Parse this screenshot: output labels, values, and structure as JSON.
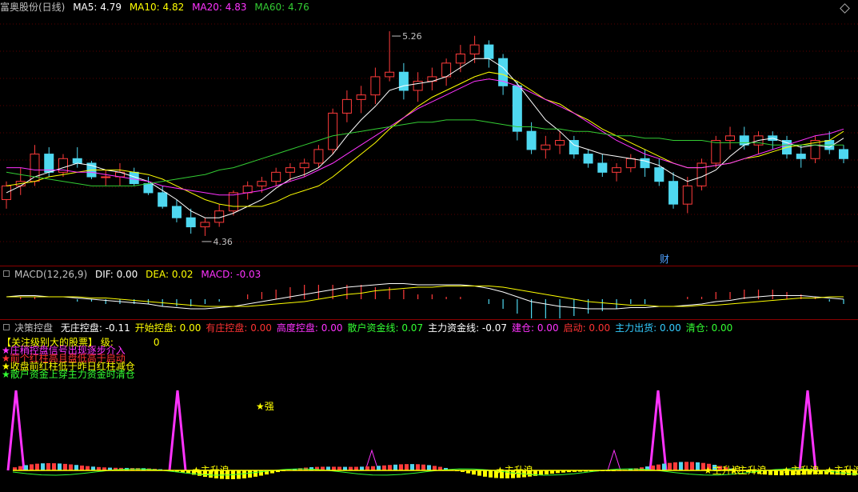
{
  "main_header": {
    "title": "富奥股份(日线)",
    "ma": [
      {
        "label": "MA5:",
        "value": "4.79",
        "color": "#ffffff"
      },
      {
        "label": "MA10:",
        "value": "4.82",
        "color": "#ffff00"
      },
      {
        "label": "MA20:",
        "value": "4.83",
        "color": "#ff33ff"
      },
      {
        "label": "MA60:",
        "value": "4.76",
        "color": "#33cc33"
      }
    ],
    "corner_icon": "diamond-icon"
  },
  "price_annotations": {
    "high": "5.26",
    "low": "4.36",
    "cai": "财"
  },
  "macd_header": {
    "title": "MACD(12,26,9)",
    "dif_label": "DIF:",
    "dif": "0.00",
    "dea_label": "DEA:",
    "dea": "0.02",
    "macd_label": "MACD:",
    "macd": "-0.03"
  },
  "indicator_header": {
    "title": "决策控盘",
    "items": [
      {
        "label": "无庄控盘:",
        "value": "-0.11",
        "color": "#ffffff"
      },
      {
        "label": "开始控盘:",
        "value": "0.00",
        "color": "#ffff00"
      },
      {
        "label": "有庄控盘:",
        "value": "0.00",
        "color": "#ff3333"
      },
      {
        "label": "高度控盘:",
        "value": "0.00",
        "color": "#ff33ff"
      },
      {
        "label": "散户资金线:",
        "value": "0.07",
        "color": "#33ff33"
      },
      {
        "label": "主力资金线:",
        "value": "-0.07",
        "color": "#ffffff"
      },
      {
        "label": "建仓:",
        "value": "0.00",
        "color": "#ff33ff"
      },
      {
        "label": "启动:",
        "value": "0.00",
        "color": "#ff3333"
      },
      {
        "label": "主力出货:",
        "value": "0.00",
        "color": "#33ccff"
      },
      {
        "label": "清仓:",
        "value": "0.00",
        "color": "#33ff33"
      }
    ]
  },
  "indicator_legend": [
    {
      "text": "【关注级别大的股票】  级:",
      "value": "0",
      "color": "#ffff00"
    },
    {
      "text": "★庄稍控盘信号出现逐步介入",
      "color": "#ff33ff"
    },
    {
      "text": "★前个红柱高且盘低高于启动",
      "color": "#ff3333"
    },
    {
      "text": "★收盘前红柱低于昨日红柱减仓",
      "color": "#ffff00"
    },
    {
      "text": "★散户资金上穿主力资金时清仓",
      "color": "#33ff33"
    }
  ],
  "indicator_marks": {
    "strong": "★强",
    "wave": "★主升浪"
  },
  "chart_data": {
    "type": "candlestick",
    "title": "富奥股份(日线)",
    "ylim": [
      4.3,
      5.32
    ],
    "annotated_high": 5.26,
    "annotated_low": 4.36,
    "ohlc": [
      [
        4.52,
        4.6,
        4.48,
        4.58
      ],
      [
        4.58,
        4.66,
        4.54,
        4.6
      ],
      [
        4.6,
        4.76,
        4.58,
        4.72
      ],
      [
        4.72,
        4.75,
        4.62,
        4.64
      ],
      [
        4.64,
        4.72,
        4.62,
        4.7
      ],
      [
        4.7,
        4.75,
        4.66,
        4.68
      ],
      [
        4.68,
        4.69,
        4.61,
        4.62
      ],
      [
        4.62,
        4.65,
        4.58,
        4.62
      ],
      [
        4.62,
        4.68,
        4.58,
        4.64
      ],
      [
        4.64,
        4.66,
        4.58,
        4.59
      ],
      [
        4.59,
        4.62,
        4.54,
        4.55
      ],
      [
        4.55,
        4.58,
        4.48,
        4.49
      ],
      [
        4.49,
        4.52,
        4.42,
        4.44
      ],
      [
        4.44,
        4.48,
        4.37,
        4.4
      ],
      [
        4.4,
        4.44,
        4.36,
        4.42
      ],
      [
        4.42,
        4.5,
        4.4,
        4.47
      ],
      [
        4.47,
        4.56,
        4.45,
        4.55
      ],
      [
        4.55,
        4.6,
        4.52,
        4.58
      ],
      [
        4.58,
        4.62,
        4.55,
        4.6
      ],
      [
        4.6,
        4.66,
        4.58,
        4.64
      ],
      [
        4.64,
        4.68,
        4.6,
        4.66
      ],
      [
        4.66,
        4.7,
        4.62,
        4.68
      ],
      [
        4.68,
        4.76,
        4.66,
        4.74
      ],
      [
        4.74,
        4.92,
        4.72,
        4.9
      ],
      [
        4.9,
        5.0,
        4.86,
        4.96
      ],
      [
        4.96,
        5.02,
        4.9,
        4.98
      ],
      [
        4.98,
        5.1,
        4.94,
        5.06
      ],
      [
        5.06,
        5.26,
        5.04,
        5.08
      ],
      [
        5.08,
        5.12,
        4.96,
        5.0
      ],
      [
        5.0,
        5.08,
        4.95,
        5.04
      ],
      [
        5.04,
        5.1,
        5.0,
        5.06
      ],
      [
        5.06,
        5.14,
        5.02,
        5.12
      ],
      [
        5.12,
        5.2,
        5.08,
        5.16
      ],
      [
        5.16,
        5.24,
        5.12,
        5.2
      ],
      [
        5.2,
        5.22,
        5.1,
        5.14
      ],
      [
        5.14,
        5.16,
        4.98,
        5.02
      ],
      [
        5.02,
        5.04,
        4.78,
        4.82
      ],
      [
        4.82,
        4.86,
        4.72,
        4.74
      ],
      [
        4.74,
        4.8,
        4.7,
        4.76
      ],
      [
        4.76,
        4.82,
        4.72,
        4.78
      ],
      [
        4.78,
        4.8,
        4.7,
        4.72
      ],
      [
        4.72,
        4.74,
        4.66,
        4.68
      ],
      [
        4.68,
        4.72,
        4.62,
        4.64
      ],
      [
        4.64,
        4.68,
        4.6,
        4.66
      ],
      [
        4.66,
        4.72,
        4.64,
        4.7
      ],
      [
        4.7,
        4.74,
        4.62,
        4.66
      ],
      [
        4.66,
        4.7,
        4.58,
        4.6
      ],
      [
        4.6,
        4.64,
        4.48,
        4.5
      ],
      [
        4.5,
        4.62,
        4.46,
        4.58
      ],
      [
        4.58,
        4.7,
        4.56,
        4.68
      ],
      [
        4.68,
        4.8,
        4.66,
        4.78
      ],
      [
        4.78,
        4.84,
        4.74,
        4.8
      ],
      [
        4.8,
        4.84,
        4.74,
        4.76
      ],
      [
        4.76,
        4.82,
        4.72,
        4.8
      ],
      [
        4.8,
        4.82,
        4.74,
        4.78
      ],
      [
        4.78,
        4.8,
        4.7,
        4.72
      ],
      [
        4.72,
        4.76,
        4.66,
        4.7
      ],
      [
        4.7,
        4.8,
        4.68,
        4.78
      ],
      [
        4.78,
        4.82,
        4.72,
        4.74
      ],
      [
        4.74,
        4.76,
        4.68,
        4.7
      ]
    ],
    "series": [
      {
        "name": "MA5",
        "color": "#ffffff",
        "values": [
          4.55,
          4.58,
          4.62,
          4.64,
          4.66,
          4.68,
          4.67,
          4.65,
          4.64,
          4.62,
          4.6,
          4.56,
          4.52,
          4.47,
          4.44,
          4.44,
          4.46,
          4.49,
          4.52,
          4.57,
          4.61,
          4.63,
          4.66,
          4.72,
          4.8,
          4.87,
          4.93,
          5.0,
          5.02,
          5.03,
          5.04,
          5.06,
          5.1,
          5.14,
          5.14,
          5.1,
          5.03,
          4.95,
          4.87,
          4.82,
          4.76,
          4.74,
          4.72,
          4.71,
          4.7,
          4.69,
          4.67,
          4.63,
          4.6,
          4.62,
          4.65,
          4.71,
          4.76,
          4.78,
          4.79,
          4.77,
          4.75,
          4.76,
          4.75,
          4.79
        ]
      },
      {
        "name": "MA10",
        "color": "#ffff00",
        "values": [
          4.58,
          4.59,
          4.6,
          4.62,
          4.63,
          4.64,
          4.65,
          4.65,
          4.65,
          4.64,
          4.63,
          4.61,
          4.58,
          4.55,
          4.52,
          4.5,
          4.49,
          4.49,
          4.49,
          4.51,
          4.54,
          4.56,
          4.58,
          4.62,
          4.67,
          4.72,
          4.77,
          4.83,
          4.88,
          4.93,
          4.97,
          5.0,
          5.03,
          5.06,
          5.08,
          5.07,
          5.04,
          5.0,
          4.96,
          4.94,
          4.9,
          4.87,
          4.83,
          4.8,
          4.77,
          4.74,
          4.71,
          4.68,
          4.66,
          4.66,
          4.67,
          4.68,
          4.7,
          4.71,
          4.73,
          4.75,
          4.76,
          4.77,
          4.78,
          4.82
        ]
      },
      {
        "name": "MA20",
        "color": "#ff33ff",
        "values": [
          4.66,
          4.66,
          4.65,
          4.65,
          4.65,
          4.64,
          4.64,
          4.63,
          4.62,
          4.61,
          4.6,
          4.58,
          4.57,
          4.56,
          4.55,
          4.54,
          4.54,
          4.55,
          4.56,
          4.58,
          4.6,
          4.62,
          4.65,
          4.68,
          4.72,
          4.76,
          4.8,
          4.84,
          4.88,
          4.92,
          4.95,
          4.98,
          5.01,
          5.04,
          5.05,
          5.04,
          5.02,
          4.99,
          4.96,
          4.93,
          4.9,
          4.86,
          4.82,
          4.78,
          4.75,
          4.72,
          4.7,
          4.68,
          4.66,
          4.66,
          4.67,
          4.68,
          4.7,
          4.72,
          4.74,
          4.76,
          4.78,
          4.8,
          4.81,
          4.83
        ]
      },
      {
        "name": "MA60",
        "color": "#33cc33",
        "values": [
          4.64,
          4.63,
          4.62,
          4.61,
          4.6,
          4.59,
          4.58,
          4.58,
          4.58,
          4.58,
          4.59,
          4.6,
          4.61,
          4.62,
          4.63,
          4.65,
          4.66,
          4.68,
          4.7,
          4.72,
          4.74,
          4.76,
          4.78,
          4.8,
          4.81,
          4.82,
          4.83,
          4.84,
          4.85,
          4.86,
          4.86,
          4.87,
          4.87,
          4.87,
          4.86,
          4.85,
          4.84,
          4.84,
          4.83,
          4.83,
          4.82,
          4.82,
          4.81,
          4.8,
          4.8,
          4.79,
          4.79,
          4.78,
          4.78,
          4.78,
          4.77,
          4.77,
          4.77,
          4.77,
          4.76,
          4.76,
          4.76,
          4.76,
          4.76,
          4.76
        ]
      }
    ],
    "macd": {
      "dif": [
        0.02,
        0.03,
        0.03,
        0.02,
        0.02,
        0.01,
        0.0,
        -0.01,
        -0.02,
        -0.03,
        -0.04,
        -0.06,
        -0.07,
        -0.08,
        -0.08,
        -0.07,
        -0.06,
        -0.04,
        -0.02,
        0.0,
        0.02,
        0.04,
        0.06,
        0.08,
        0.1,
        0.11,
        0.12,
        0.13,
        0.13,
        0.12,
        0.12,
        0.12,
        0.12,
        0.11,
        0.09,
        0.06,
        0.02,
        -0.02,
        -0.04,
        -0.06,
        -0.07,
        -0.08,
        -0.08,
        -0.08,
        -0.07,
        -0.07,
        -0.06,
        -0.06,
        -0.05,
        -0.04,
        -0.02,
        -0.01,
        0.01,
        0.02,
        0.03,
        0.03,
        0.03,
        0.02,
        0.01,
        0.0
      ],
      "dea": [
        0.02,
        0.02,
        0.02,
        0.02,
        0.02,
        0.02,
        0.01,
        0.01,
        0.0,
        -0.01,
        -0.02,
        -0.03,
        -0.04,
        -0.05,
        -0.06,
        -0.06,
        -0.06,
        -0.06,
        -0.05,
        -0.04,
        -0.03,
        -0.02,
        0.0,
        0.02,
        0.04,
        0.05,
        0.07,
        0.08,
        0.09,
        0.1,
        0.1,
        0.11,
        0.11,
        0.11,
        0.11,
        0.1,
        0.08,
        0.06,
        0.04,
        0.02,
        0.0,
        -0.02,
        -0.03,
        -0.04,
        -0.05,
        -0.05,
        -0.06,
        -0.06,
        -0.06,
        -0.05,
        -0.05,
        -0.04,
        -0.03,
        -0.02,
        -0.01,
        0.0,
        0.01,
        0.01,
        0.02,
        0.02
      ]
    }
  }
}
